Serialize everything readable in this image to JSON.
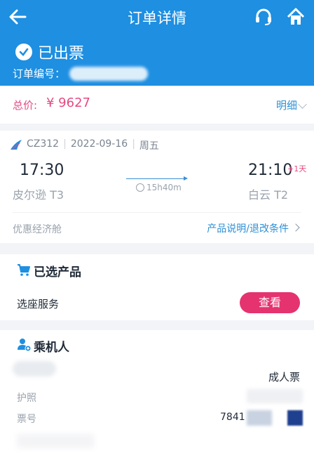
{
  "header": {
    "title": "订单详情",
    "icons": [
      "back-arrow-icon",
      "headset-icon",
      "home-icon"
    ],
    "color": "#1e8fe1"
  },
  "status": {
    "label": "已出票",
    "order_label": "订单编号："
  },
  "total": {
    "label": "总价:",
    "value": "¥ 9627",
    "detail_label": "明细"
  },
  "flight": {
    "flight_no": "CZ312",
    "date": "2022-09-16",
    "weekday": "周五",
    "dep_time": "17:30",
    "dep_airport": "皮尔逊 T3",
    "arr_time": "21:10",
    "plus_day": "+1天",
    "arr_airport": "白云 T2",
    "duration": "15h40m",
    "cabin": "优惠经济舱",
    "rules_link": "产品说明/退改条件"
  },
  "products": {
    "title": "已选产品",
    "seat_label": "选座服务",
    "view_button": "查看"
  },
  "passenger": {
    "title": "乘机人",
    "ticket_type": "成人票",
    "passport_label": "护照",
    "ticket_label": "票号",
    "ticket_prefix": "7841"
  },
  "colors": {
    "accent_pink": "#e54a83",
    "link_blue": "#2c8fd6",
    "button": "#e5336f"
  }
}
